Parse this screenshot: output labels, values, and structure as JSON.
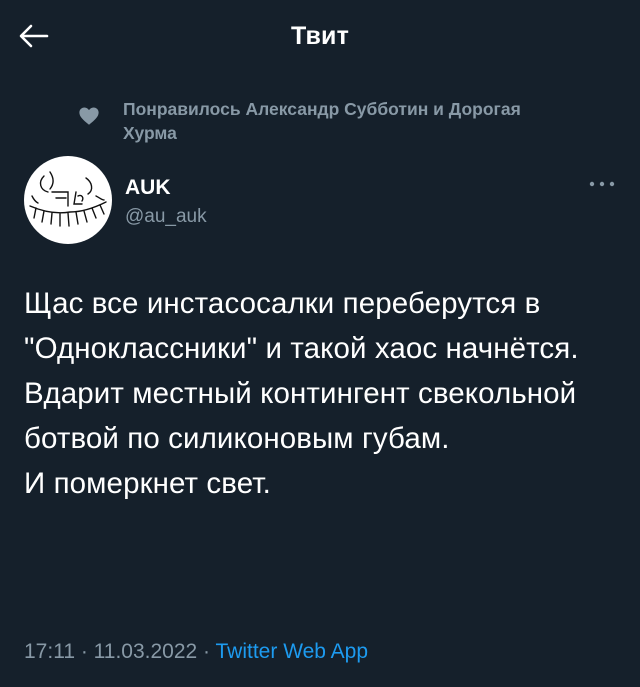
{
  "header": {
    "title": "Твит",
    "back_icon": "arrow-left-icon"
  },
  "liked_by": {
    "icon": "heart-icon",
    "text": "Понравилось Александр Субботин и Дорогая Хурма"
  },
  "author": {
    "name": "AUK",
    "handle": "@au_auk",
    "avatar": "avatar-drawing"
  },
  "tweet": {
    "text": "Щас все инстасосалки переберутся в \"Одноклассники\" и такой хаос начнётся.\nВдарит местный контингент свекольной ботвой по силиконовым губам.\nИ померкнет свет."
  },
  "meta": {
    "time": "17:11",
    "separator": " · ",
    "date": "11.03.2022",
    "source": "Twitter Web App"
  },
  "colors": {
    "background": "#15202b",
    "muted": "#8899a6",
    "link": "#1d9bf0"
  }
}
